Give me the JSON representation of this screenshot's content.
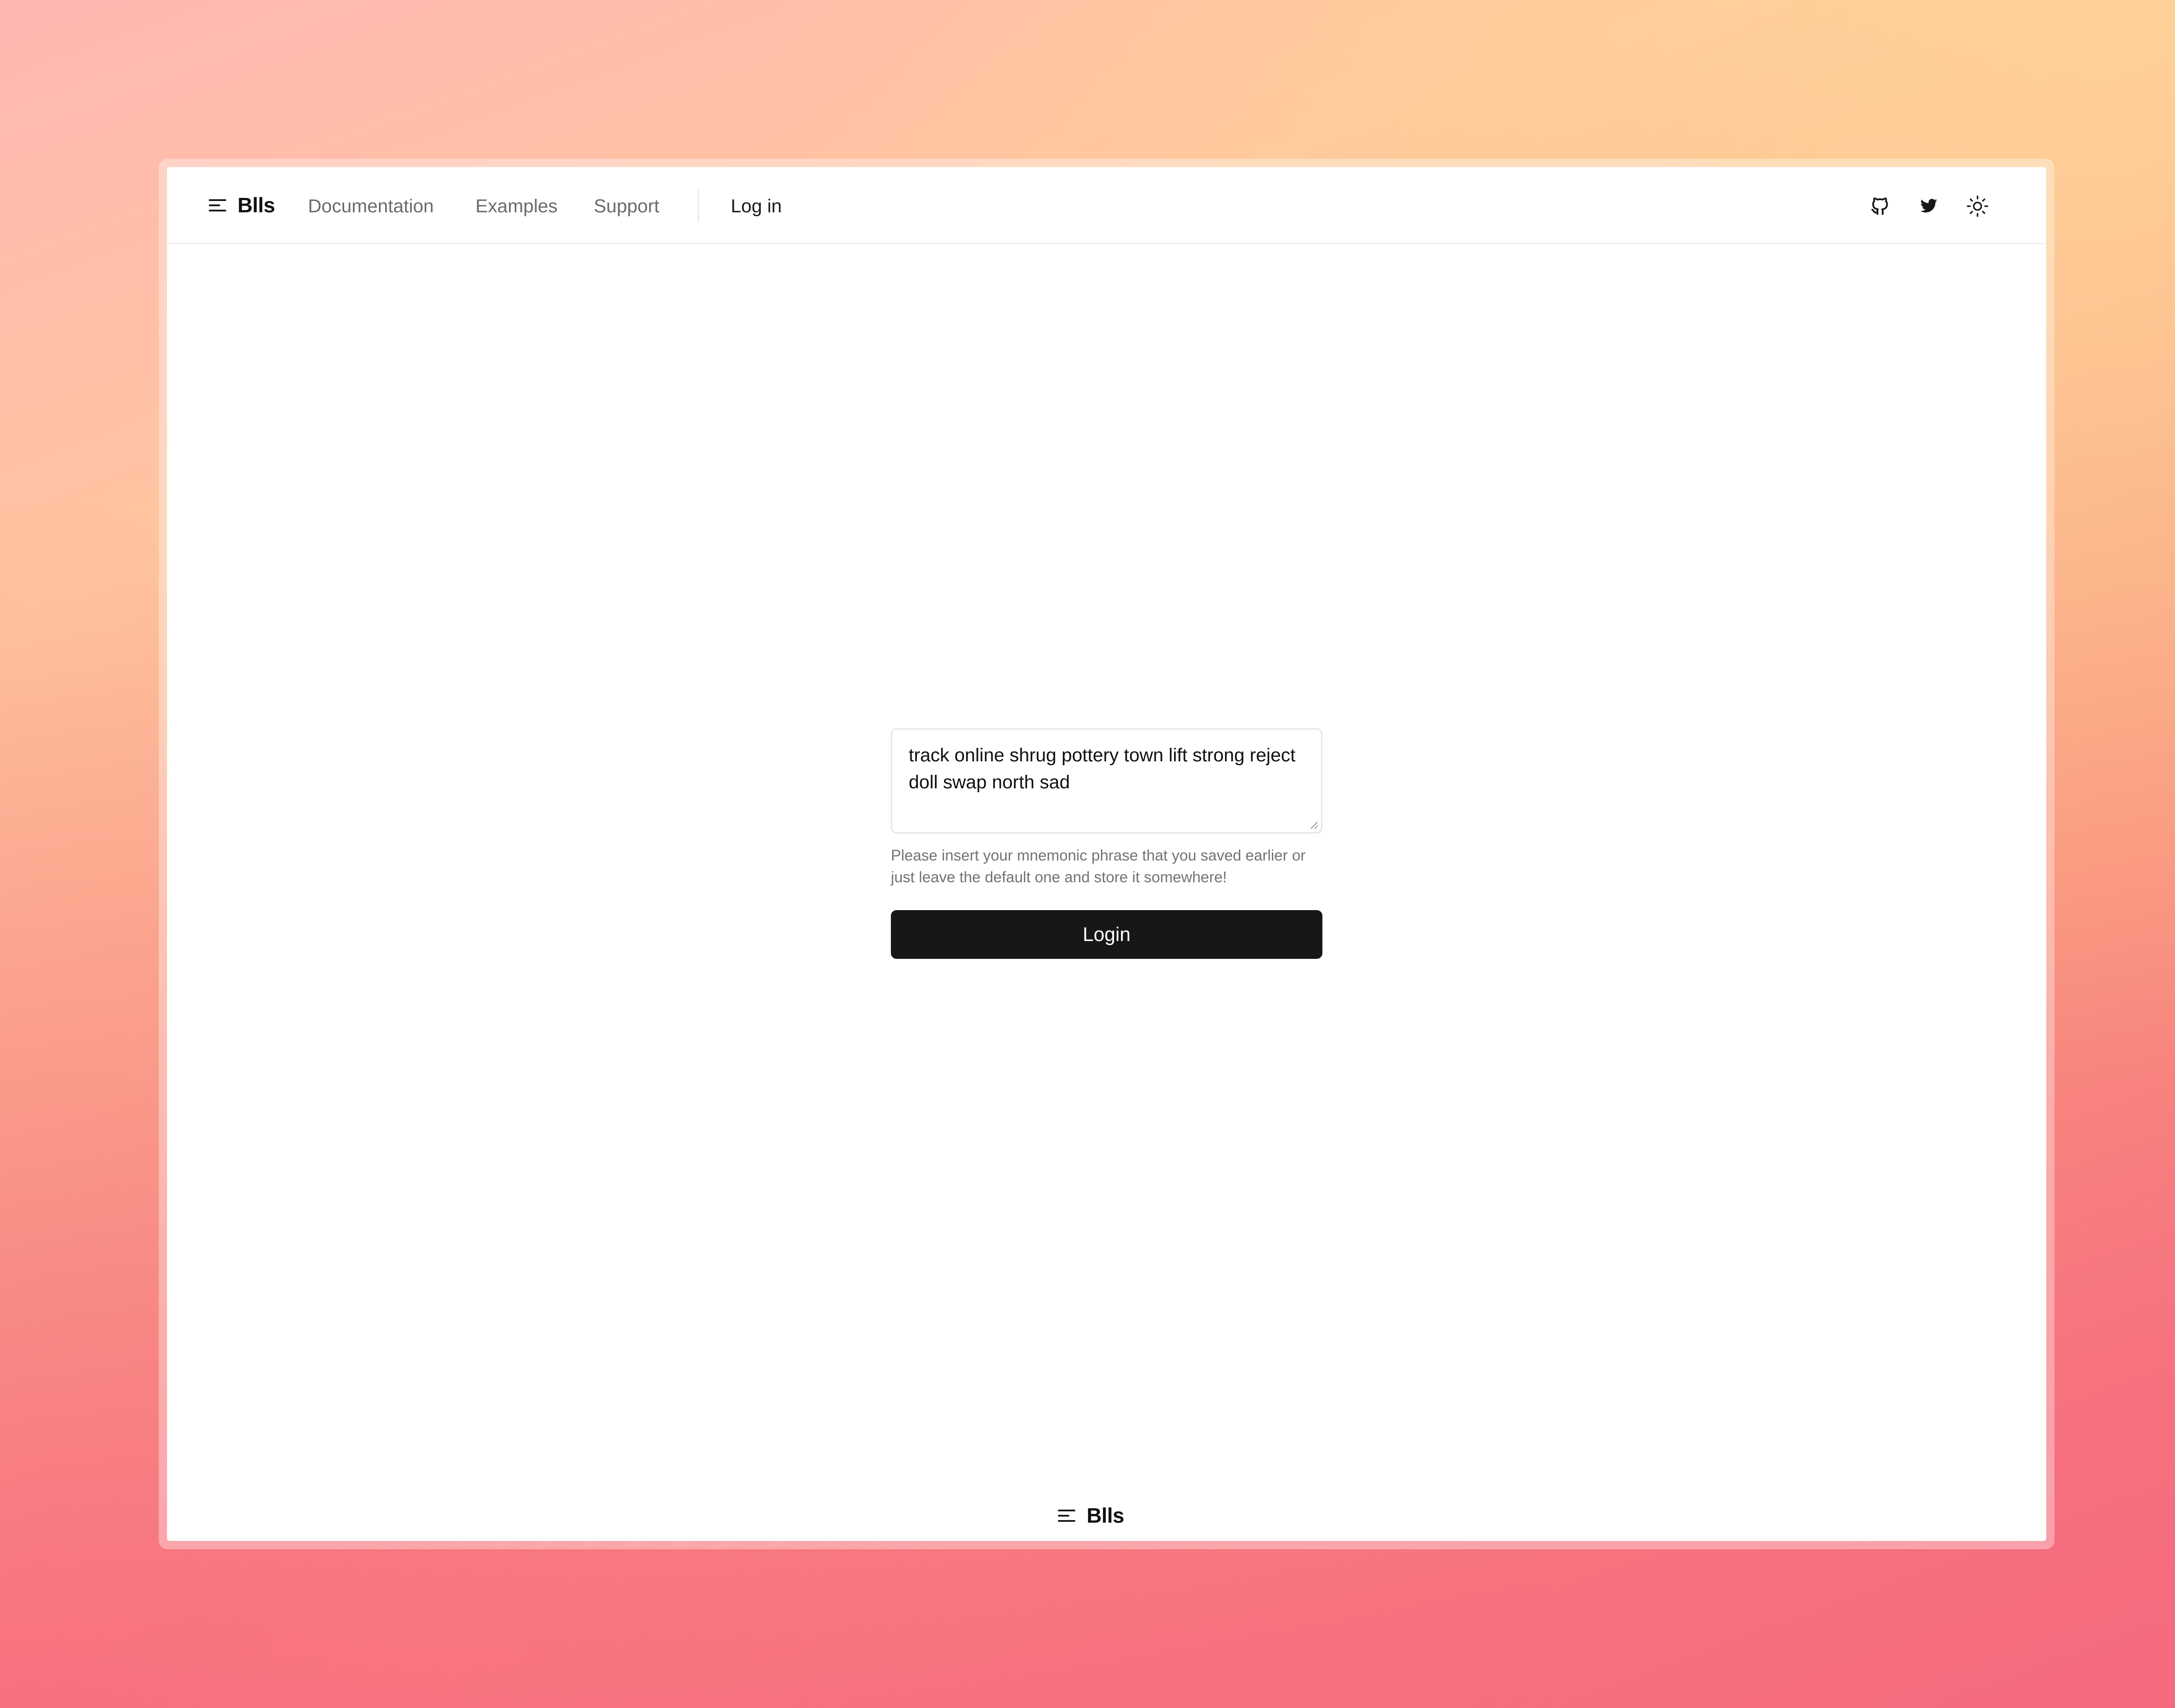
{
  "app": {
    "brand_name": "Blls",
    "brand_icon": "menu-lines-icon"
  },
  "navbar": {
    "links": [
      {
        "label": "Documentation"
      },
      {
        "label": "Examples"
      },
      {
        "label": "Support"
      }
    ],
    "login_label": "Log in",
    "icons": [
      "github-icon",
      "twitter-icon",
      "sun-icon"
    ]
  },
  "login_form": {
    "mnemonic_value": "track online shrug pottery town lift strong reject doll swap north sad",
    "help_text": "Please insert your mnemonic phrase that you saved earlier or just leave the default one and store it somewhere!",
    "submit_label": "Login"
  },
  "footer": {
    "brand_name": "Blls"
  },
  "colors": {
    "primary_button": "#171717",
    "muted_text": "#737373",
    "nav_text": "#6b6b6b"
  }
}
